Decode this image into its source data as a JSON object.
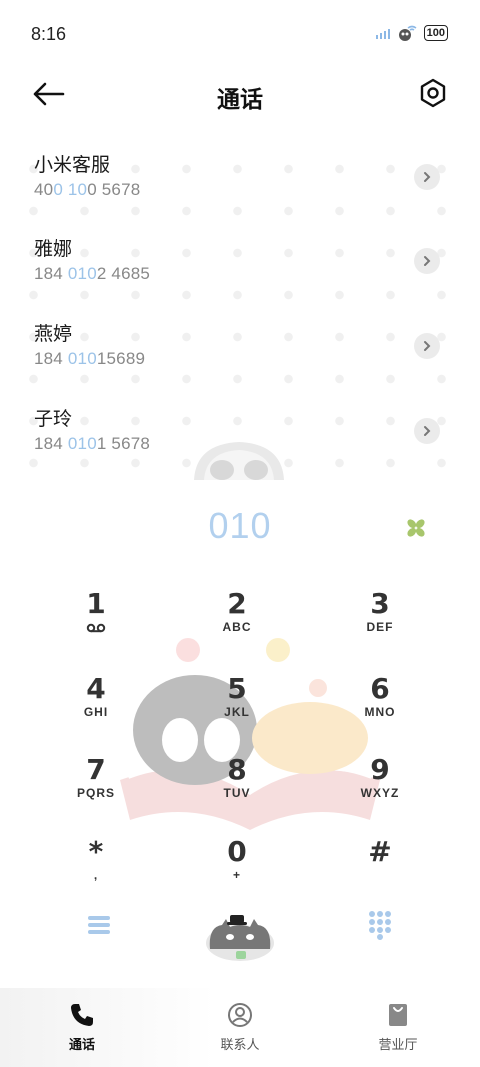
{
  "status": {
    "time": "8:16",
    "battery": "100"
  },
  "header": {
    "title": "通话"
  },
  "contacts": [
    {
      "name": "小米客服",
      "num_pre": "40",
      "num_hl1": "0 10",
      "num_post": "0 5678"
    },
    {
      "name": "雅娜",
      "num_pre": "184 ",
      "num_hl1": "010",
      "num_post": "2 4685"
    },
    {
      "name": "燕婷",
      "num_pre": "184 ",
      "num_hl1": "010",
      "num_post": "15689"
    },
    {
      "name": "子玲",
      "num_pre": "184 ",
      "num_hl1": "010",
      "num_post": "1 5678"
    }
  ],
  "dialer": {
    "input": "010",
    "keys": [
      {
        "digit": "1",
        "letters": ""
      },
      {
        "digit": "2",
        "letters": "ABC"
      },
      {
        "digit": "3",
        "letters": "DEF"
      },
      {
        "digit": "4",
        "letters": "GHI"
      },
      {
        "digit": "5",
        "letters": "JKL"
      },
      {
        "digit": "6",
        "letters": "MNO"
      },
      {
        "digit": "7",
        "letters": "PQRS"
      },
      {
        "digit": "8",
        "letters": "TUV"
      },
      {
        "digit": "9",
        "letters": "WXYZ"
      },
      {
        "digit": "*",
        "letters": ","
      },
      {
        "digit": "0",
        "letters": "+"
      },
      {
        "digit": "#",
        "letters": ""
      }
    ]
  },
  "tabs": [
    {
      "label": "通话",
      "icon": "phone-icon",
      "active": true
    },
    {
      "label": "联系人",
      "icon": "contacts-icon",
      "active": false
    },
    {
      "label": "营业厅",
      "icon": "shop-bag-icon",
      "active": false
    }
  ],
  "colors": {
    "accent": "#9cc3e8",
    "dial_text": "#b2d0ee",
    "delete": "#a8c66c"
  }
}
